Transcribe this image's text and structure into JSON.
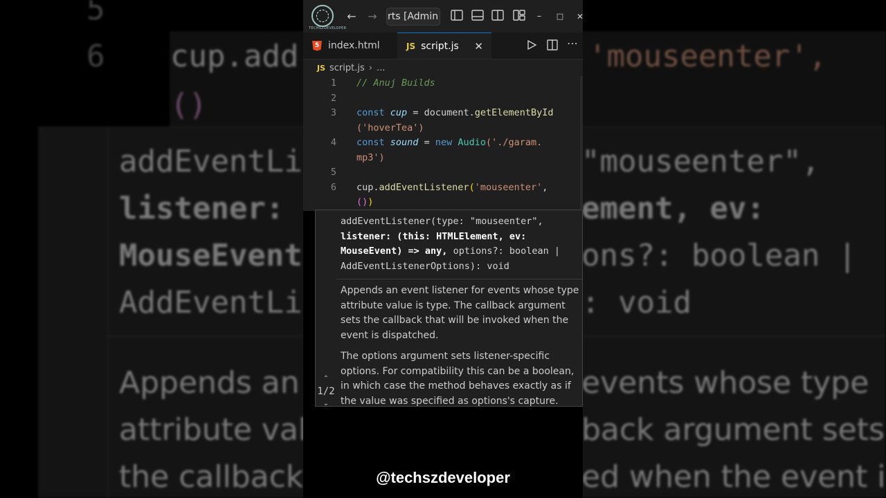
{
  "window": {
    "logo_text": "TECHSZDEVELOPER",
    "title": "rts [Admini"
  },
  "tabs": [
    {
      "label": "index.html",
      "icon": "html5-icon"
    },
    {
      "label": "script.js",
      "icon": "js-icon",
      "close": "✕"
    }
  ],
  "breadcrumb": {
    "file": "script.js",
    "separator": "›",
    "more": "..."
  },
  "editor": {
    "line_numbers": [
      "1",
      "2",
      "3",
      "",
      "4",
      "",
      "5",
      "6",
      ""
    ],
    "line1": "// Anuj Builds",
    "line3a_kw": "const",
    "line3a_var": "cup",
    "line3a_eq": "=",
    "line3a_obj": "document.",
    "line3a_fn": "getElementById",
    "line3b_str": "('hoverTea')",
    "line4a_kw": "const",
    "line4a_var": "sound",
    "line4a_eq": "=",
    "line4a_new": "new",
    "line4a_cls": "Audio",
    "line4a_str": "('./garam.",
    "line4b_str": "mp3')",
    "line6a_obj": "cup.",
    "line6a_fn": "addEventListener",
    "line6a_paren": "(",
    "line6a_str": "'mouseenter'",
    "line6a_comma": ",",
    "line6b_parens": "()",
    "line6b_close": ")"
  },
  "hover": {
    "sig_part1": "addEventListener(type: \"mouseenter\",",
    "sig_bold1": "listener: (this: HTMLElement, ev:",
    "sig_bold2": "MouseEvent) => any,",
    "sig_part2": " options?: boolean |",
    "sig_part3": "AddEventListenerOptions): void",
    "doc1": "Appends an event listener for events whose type attribute value is type. The callback argument sets the callback that will be invoked when the event is dispatched.",
    "doc2": "The options argument sets listener-specific options. For compatibility this can be a boolean, in which case the method behaves exactly as if the value was specified as options's capture.",
    "pager": "1/2"
  },
  "background": {
    "line_num_5": "5",
    "line_num_6": "6",
    "code1": "cup.add",
    "code1b": "'mouseenter',",
    "code2": "()",
    "code2b": ")",
    "h1a": "addEventLi",
    "h1b": "\"mouseenter\",",
    "h2a": "listener:",
    "h2b": "ement, ev:",
    "h3a": "MouseEvent",
    "h3b": "ons?: boolean |",
    "h4a": "AddEventLi",
    "h4b": ": void",
    "d1a": "Appends an",
    "d1b": "events whose type",
    "d2a": "attribute val",
    "d2b": "back argument sets",
    "d3a": "the callback",
    "d3b": "ed when the event is"
  },
  "watermark": "@techszdeveloper"
}
